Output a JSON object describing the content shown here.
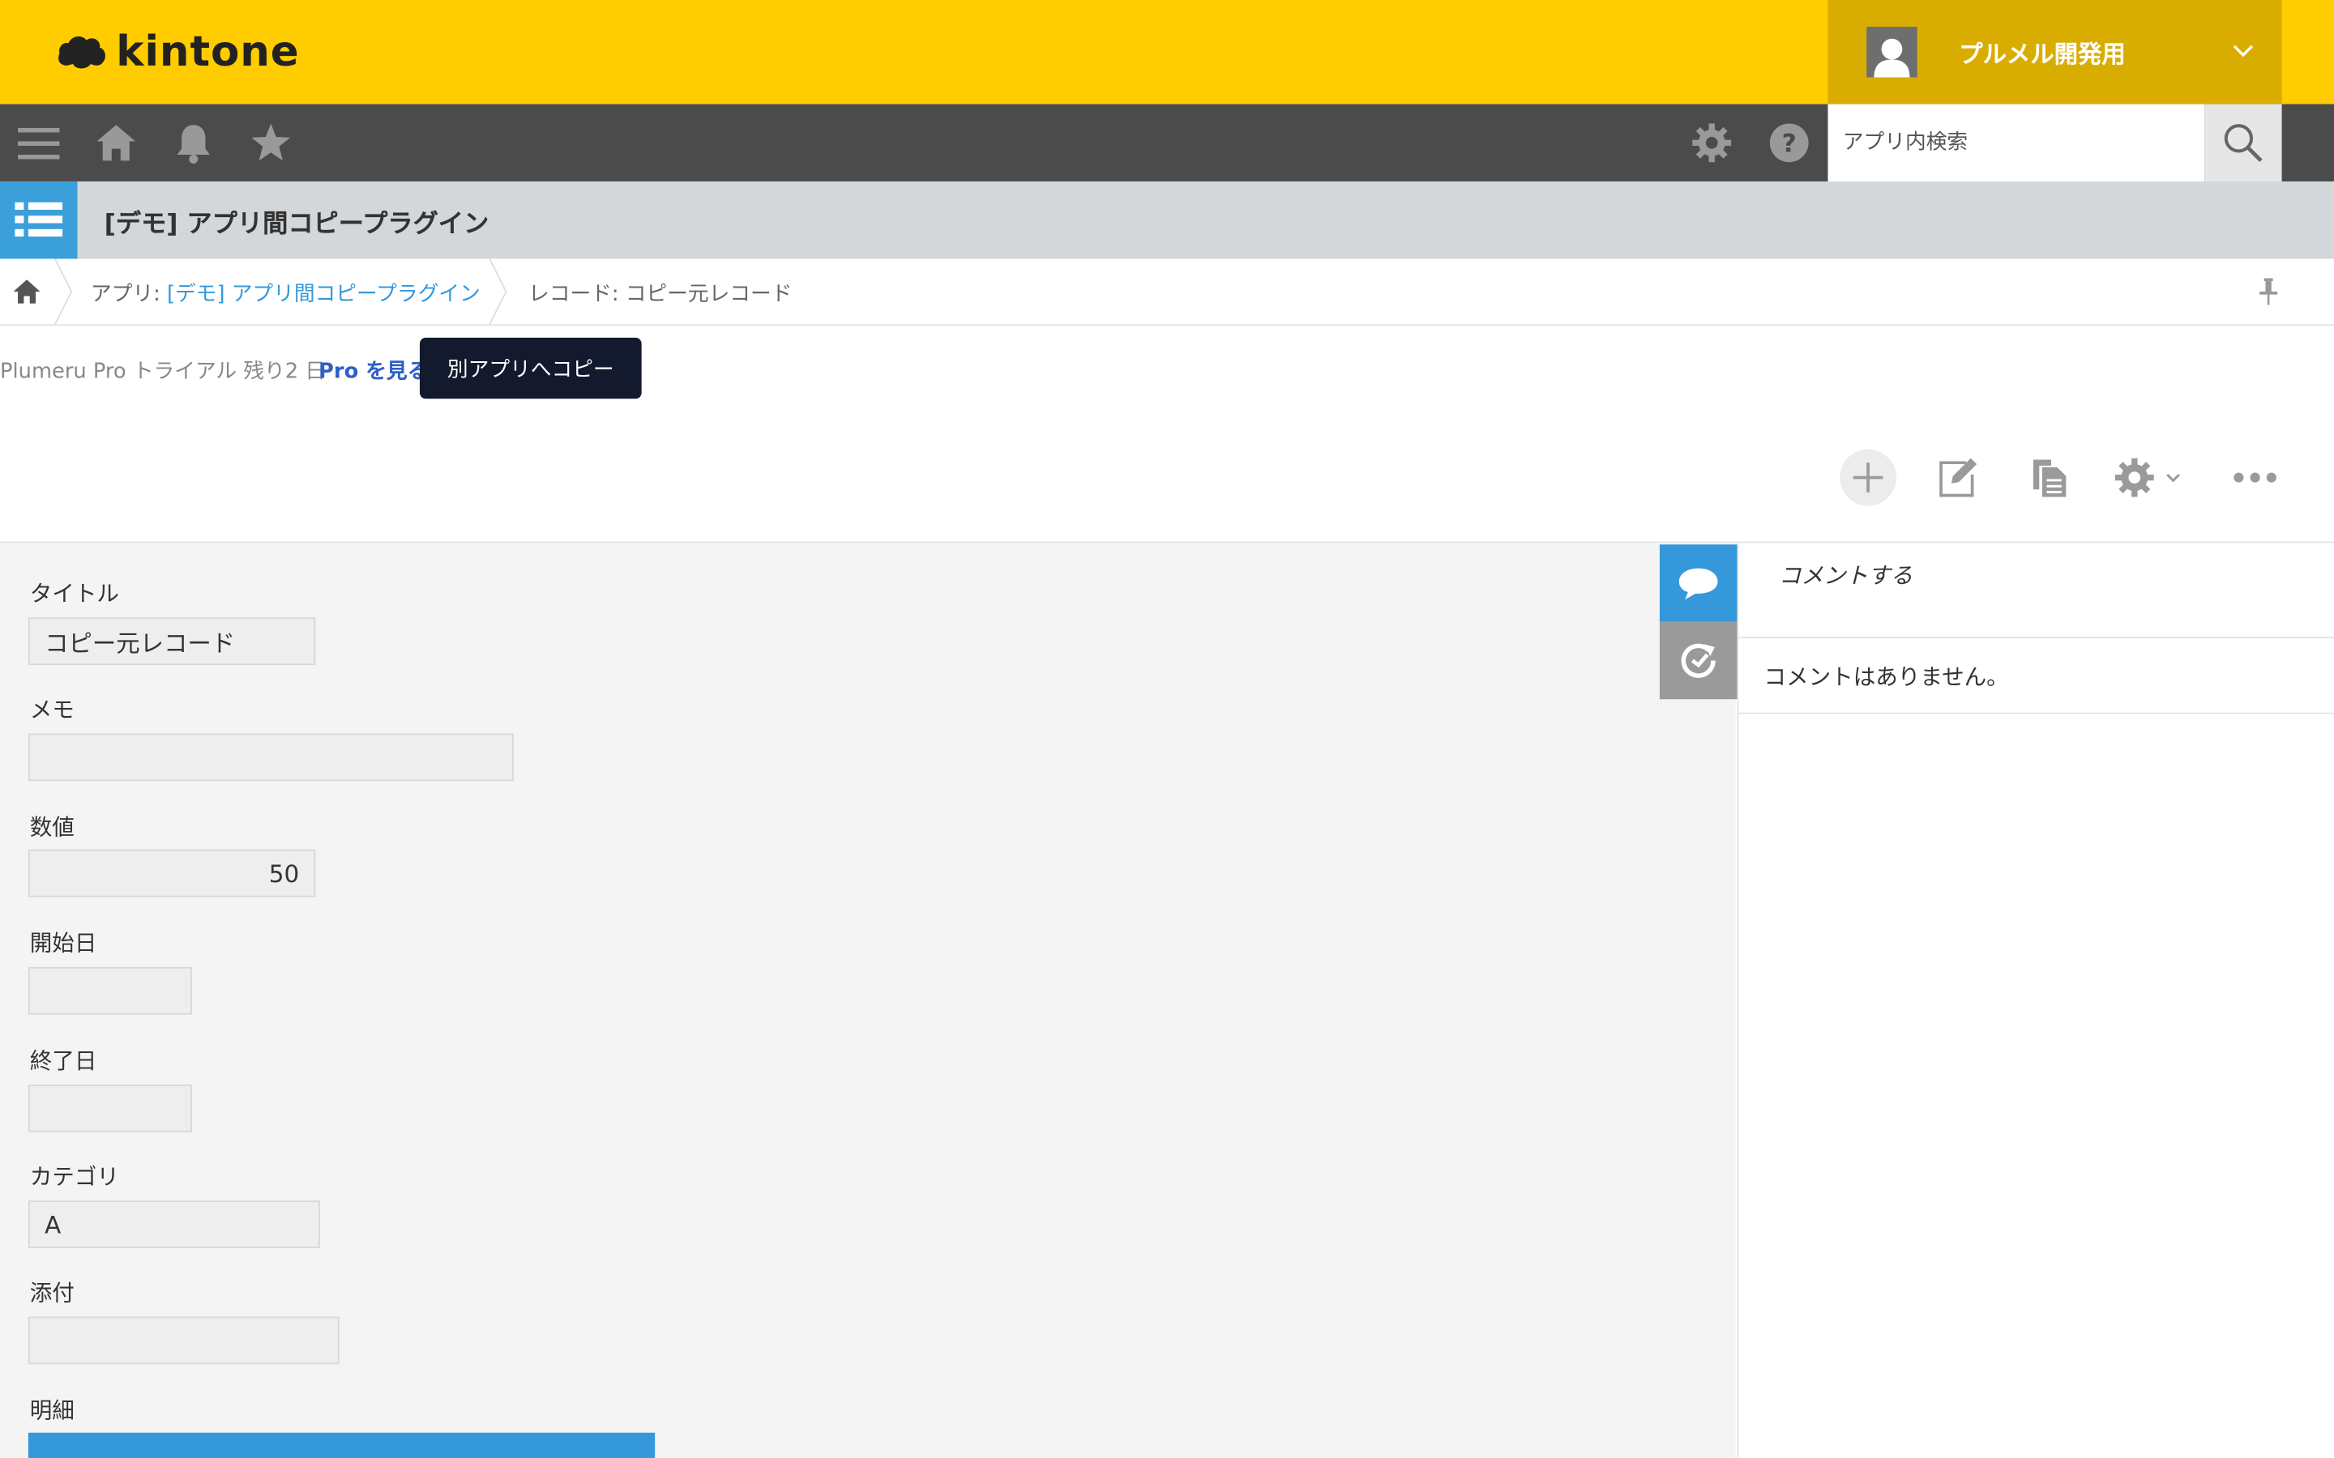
{
  "header": {
    "logo_text": "kintone",
    "user_name": "プルメル開発用",
    "brand_color": "#ffcc00"
  },
  "nav": {
    "icons": [
      "menu-icon",
      "home-icon",
      "bell-icon",
      "star-icon",
      "gear-icon",
      "help-icon"
    ],
    "search_placeholder": "アプリ内検索"
  },
  "app": {
    "title": "[デモ] アプリ間コピープラグイン"
  },
  "breadcrumb": {
    "app_prefix": "アプリ: ",
    "app_link": "[デモ] アプリ間コピープラグイン",
    "record": "レコード: コピー元レコード"
  },
  "plugin": {
    "trial_text": "Plumeru Pro トライアル 残り2 日",
    "pro_link": "Pro を見る",
    "copy_button": "別アプリへコピー"
  },
  "toolbar": {
    "icons": [
      "add-icon",
      "edit-icon",
      "duplicate-icon",
      "settings-icon",
      "more-icon"
    ]
  },
  "form": {
    "fields": [
      {
        "label": "タイトル",
        "value": "コピー元レコード"
      },
      {
        "label": "メモ",
        "value": ""
      },
      {
        "label": "数値",
        "value": "50"
      },
      {
        "label": "開始日",
        "value": ""
      },
      {
        "label": "終了日",
        "value": ""
      },
      {
        "label": "カテゴリ",
        "value": "A"
      },
      {
        "label": "添付",
        "value": ""
      },
      {
        "label": "明細",
        "value": ""
      }
    ]
  },
  "comments": {
    "input_placeholder": "コメントする",
    "empty_text": "コメントはありません。"
  }
}
